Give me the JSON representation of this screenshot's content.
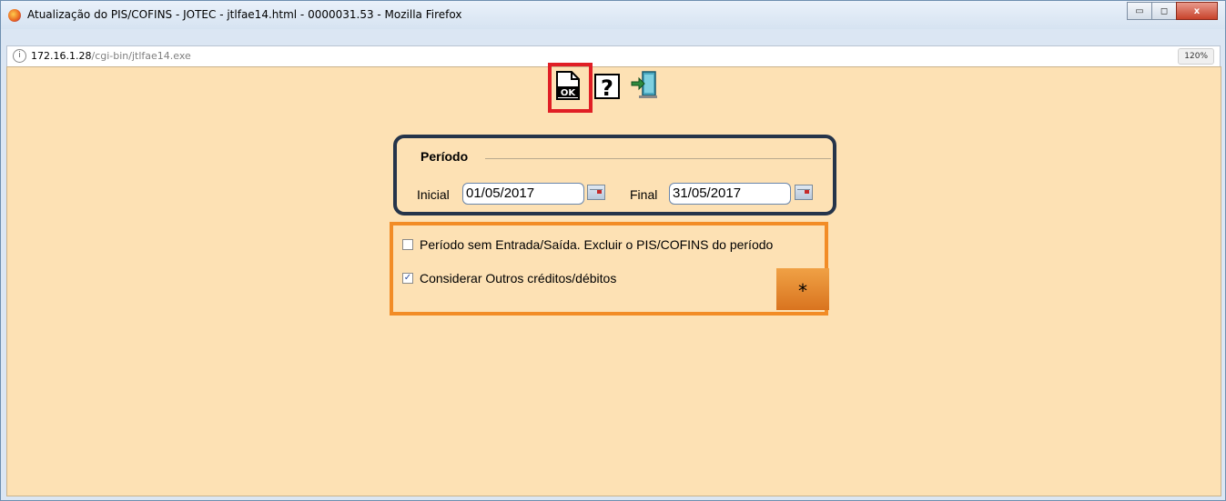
{
  "window": {
    "title": "Atualização do PIS/COFINS - JOTEC - jtlfae14.html - 0000031.53 - Mozilla Firefox",
    "minimize_label": "▭",
    "maximize_label": "◻",
    "close_label": "x"
  },
  "address_bar": {
    "host": "172.16.1.28",
    "path": "/cgi-bin/jtlfae14.exe",
    "zoom": "120%"
  },
  "toolbar": {
    "icons": [
      "ok-icon",
      "help-icon",
      "exit-icon"
    ]
  },
  "periodo": {
    "legend": "Período",
    "inicial_label": "Inicial",
    "inicial_value": "01/05/2017",
    "final_label": "Final",
    "final_value": "31/05/2017"
  },
  "options": {
    "sem_movimento_label": "Período sem Entrada/Saída. Excluir o PIS/COFINS do período",
    "sem_movimento_checked": false,
    "outros_label": "Considerar Outros créditos/débitos",
    "outros_checked": true,
    "star_button_label": "*"
  },
  "colors": {
    "page_background": "#fde1b4",
    "ok_highlight": "#e01e25",
    "periodo_border": "#25344a",
    "options_border": "#f28c26",
    "star_button": "#e2842c"
  }
}
